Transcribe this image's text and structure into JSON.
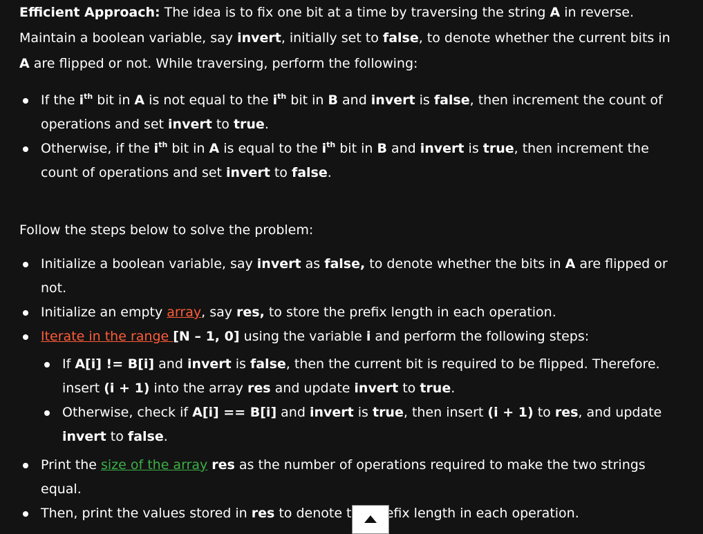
{
  "intro": {
    "label": "Efficient Approach:",
    "t1": " The idea is to fix one bit at a time by traversing the string ",
    "a": "A",
    "t2": " in reverse. Maintain a boolean variable, say ",
    "invert": "invert",
    "t3": ", initially set to ",
    "false": "false",
    "t4": ", to denote whether the current bits in ",
    "a2": "A",
    "t5": " are flipped or not. While traversing, perform the following:"
  },
  "list1": {
    "item1": {
      "t1": "If the ",
      "sup": "ith",
      "t2": " bit in ",
      "a": "A",
      "t3": " is not equal to the ",
      "t4": " bit in ",
      "b": "B",
      "t5": " and ",
      "invert": "invert",
      "t6": " is ",
      "false": "false",
      "t7": ", then increment the count of operations and set ",
      "invert2": "invert",
      "t8": " to ",
      "true": "true",
      "t9": "."
    },
    "item2": {
      "t1": "Otherwise, if the ",
      "sup": "ith",
      "t2": " bit in ",
      "a": "A",
      "t3": " is equal to the ",
      "t4": " bit in ",
      "b": "B",
      "t5": " and ",
      "invert": "invert",
      "t6": " is ",
      "true": "true",
      "t7": ", then increment the count of operations and set ",
      "invert2": "invert",
      "t8": " to ",
      "false": "false",
      "t9": "."
    }
  },
  "steps_intro": "Follow the steps below to solve the problem:",
  "list2": {
    "item1": {
      "t1": "Initialize a boolean variable, say ",
      "invert": "invert",
      "t2": " as ",
      "false": "false,",
      "t3": " to denote whether the bits in ",
      "a": "A",
      "t4": " are flipped or not."
    },
    "item2": {
      "t1": "Initialize an empty ",
      "link": "array",
      "t2": ", say ",
      "res": "res,",
      "t3": " to store the prefix length in each operation."
    },
    "item3": {
      "link": "Iterate in the range ",
      "range": "[N – 1, 0]",
      "t1": " using the variable ",
      "i": "i",
      "t2": " and perform the following steps:",
      "sub1": {
        "t1": "If ",
        "cond": "A[i] != B[i]",
        "t2": " and ",
        "invert": "invert",
        "t3": " is ",
        "false": "false",
        "t4": ", then the current bit is required to be flipped. Therefore. insert ",
        "expr": "(i + 1)",
        "t5": " into the array ",
        "res": "res",
        "t6": " and update ",
        "invert2": "invert",
        "t7": " to ",
        "true": "true",
        "t8": "."
      },
      "sub2": {
        "t1": "Otherwise, check if ",
        "cond": "A[i] == B[i]",
        "t2": " and ",
        "invert": "invert",
        "t3": " is ",
        "true": "true",
        "t4": ", then insert ",
        "expr": "(i + 1)",
        "t5": " to ",
        "res": "res",
        "t6": ", and update ",
        "invert2": "invert",
        "t7": " to ",
        "false": "false",
        "t8": "."
      }
    },
    "item4": {
      "t1": "Print the ",
      "link": "size of the array",
      "t2": " ",
      "res": "res",
      "t3": " as the number of operations required to make the two strings equal."
    },
    "item5": {
      "t1": "Then, print the values stored in ",
      "res": "res",
      "t2": " to denote the prefix length in each operation."
    }
  },
  "colors": {
    "background": "#131313",
    "text": "#ffffff",
    "link_red": "#ff5c38",
    "link_green": "#3bb045"
  },
  "icons": {
    "scroll_top": "caret-up-icon"
  }
}
